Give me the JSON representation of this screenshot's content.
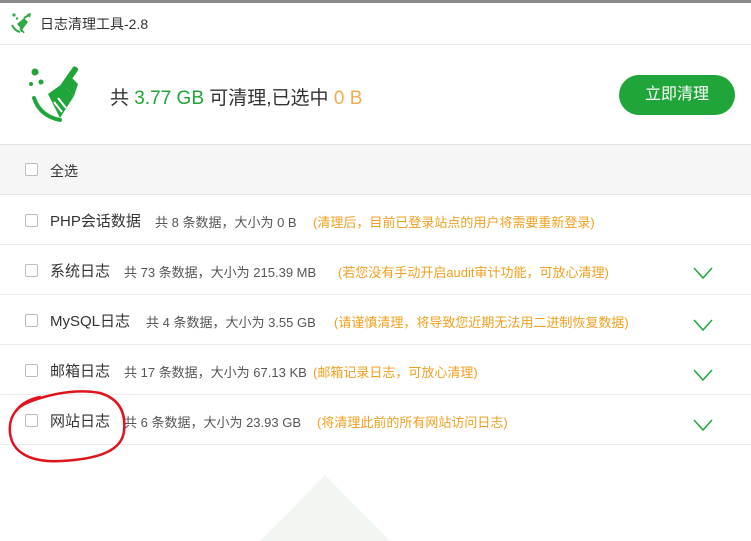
{
  "window": {
    "title": "日志清理工具-2.8"
  },
  "summary": {
    "prefix": "共 ",
    "total_size": "3.77 GB",
    "middle": " 可清理,已选中 ",
    "selected_size": "0 B",
    "clean_button": "立即清理"
  },
  "select_all": {
    "label": "全选",
    "checked": false
  },
  "items": [
    {
      "name": "PHP会话数据",
      "info": "共 8 条数据，大小为 0 B",
      "note": "(清理后，目前已登录站点的用户将需要重新登录)",
      "expandable": false,
      "checked": false
    },
    {
      "name": "系统日志",
      "info": "共 73 条数据，大小为 215.39 MB",
      "note": "(若您没有手动开启audit审计功能，可放心清理)",
      "expandable": true,
      "checked": false
    },
    {
      "name": "MySQL日志",
      "info": "共 4 条数据，大小为 3.55 GB",
      "note": "(请谨慎清理，将导致您近期无法用二进制恢复数据)",
      "expandable": true,
      "checked": false
    },
    {
      "name": "邮箱日志",
      "info": "共 17 条数据，大小为 67.13 KB",
      "note": "(邮箱记录日志，可放心清理)",
      "expandable": true,
      "checked": false
    },
    {
      "name": "网站日志",
      "info": "共 6 条数据，大小为 23.93 GB",
      "note": "(将清理此前的所有网站访问日志)",
      "expandable": true,
      "checked": false
    }
  ],
  "colors": {
    "accent_green": "#20a53a",
    "highlight_orange": "#f0ad4e",
    "note_orange": "#f0a020",
    "annotation_red": "#e0141e"
  }
}
